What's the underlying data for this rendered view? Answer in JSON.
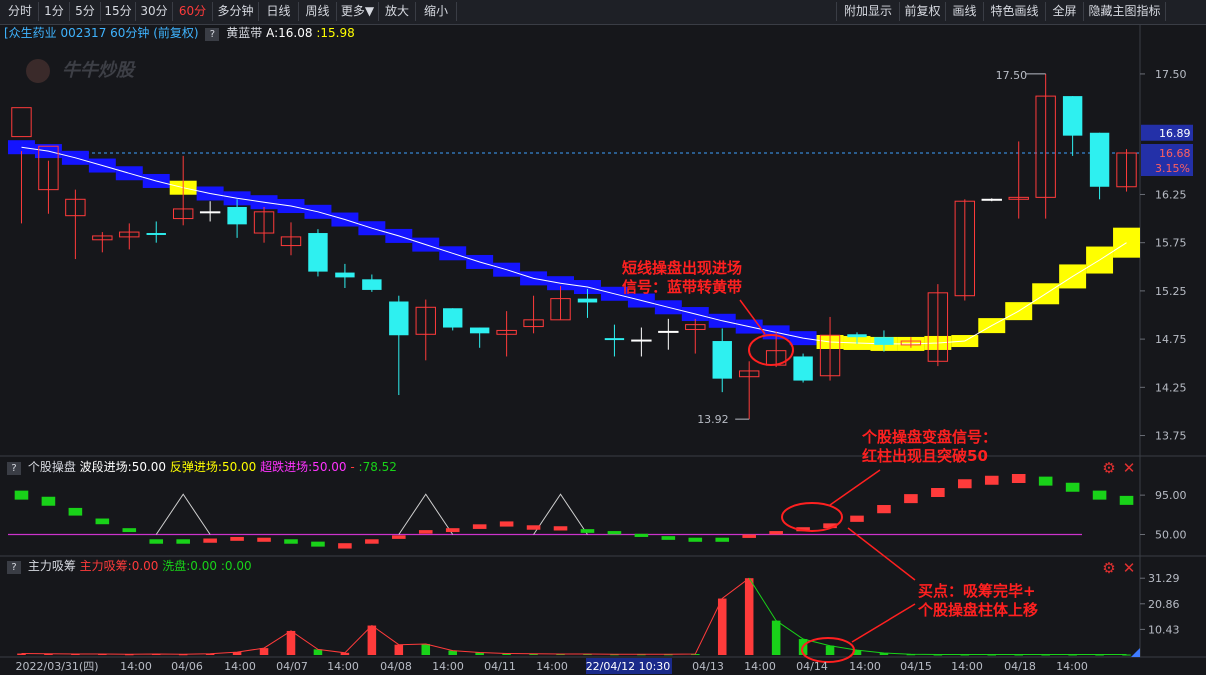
{
  "toolbar": {
    "left": [
      "分时",
      "1分",
      "5分",
      "15分",
      "30分",
      "60分",
      "多分钟",
      "日线",
      "周线",
      "更多▼",
      "放大",
      "缩小"
    ],
    "active_label": "60分",
    "right": [
      "附加显示",
      "前复权",
      "画线",
      "特色画线",
      "全屏",
      "隐藏主图指标"
    ]
  },
  "main_panel": {
    "stock": "[众生药业",
    "code": "002317 60分钟",
    "adjust": "(前复权)",
    "indicator_name": "黄蓝带",
    "a_label": "A:16.08",
    "b_value": ":15.98",
    "watermark": "牛牛炒股",
    "price_labels": [
      "17.50",
      "16.25",
      "15.75",
      "15.25",
      "14.75",
      "14.25",
      "13.75"
    ],
    "tag_high": "16.89",
    "tag_last": "16.68",
    "tag_pct": "3.15%",
    "max_label": "17.50",
    "min_label": "13.92",
    "annotation1_line1": "短线操盘出现进场",
    "annotation1_line2": "信号：蓝带转黄带"
  },
  "panel2": {
    "name": "个股操盘",
    "l1": "波段进场:50.00",
    "l2": "反弹进场:50.00",
    "l3": "超跌进场:50.00",
    "l4": "-",
    "l5": ":78.52",
    "axis": [
      "95.00",
      "50.00"
    ],
    "annotation_line1": "个股操盘变盘信号：",
    "annotation_line2": "红柱出现且突破50"
  },
  "panel3": {
    "name": "主力吸筹",
    "l1": "主力吸筹:0.00",
    "l2": "洗盘:0.00",
    "l3": ":0.00",
    "axis": [
      "31.29",
      "20.86",
      "10.43"
    ],
    "annotation_line1": "买点：吸筹完毕+",
    "annotation_line2": "个股操盘柱体上移"
  },
  "x_axis": [
    "2022/03/31(四)",
    "14:00",
    "04/06",
    "14:00",
    "04/07",
    "14:00",
    "04/08",
    "14:00",
    "04/11",
    "14:00",
    "22/04/12 10:30",
    "04/13",
    "14:00",
    "04/14",
    "14:00",
    "04/15",
    "14:00",
    "04/18",
    "14:00"
  ],
  "colors": {
    "up": "#ff3b3b",
    "down": "#2ef0f0",
    "blue_band": "#1414ff",
    "yellow_band": "#ffff00",
    "green": "#19d219",
    "magenta": "#cc33cc",
    "accent_tag": "#2330a8"
  },
  "chart_data": {
    "type": "candlestick",
    "candles": [
      [
        16.85,
        17.15,
        16.7,
        15.95
      ],
      [
        16.3,
        16.75,
        16.6,
        16.05
      ],
      [
        16.03,
        16.2,
        16.3,
        15.58
      ],
      [
        15.78,
        15.82,
        15.86,
        15.65
      ],
      [
        15.81,
        15.86,
        15.95,
        15.68
      ],
      [
        15.85,
        15.83,
        15.97,
        15.75
      ],
      [
        16.0,
        16.1,
        16.65,
        15.93
      ],
      [
        16.07,
        16.07,
        16.18,
        15.97
      ],
      [
        16.12,
        15.94,
        16.2,
        15.8
      ],
      [
        15.85,
        16.07,
        16.12,
        15.75
      ],
      [
        15.72,
        15.81,
        15.96,
        15.62
      ],
      [
        15.85,
        15.45,
        15.89,
        15.4
      ],
      [
        15.44,
        15.39,
        15.53,
        15.28
      ],
      [
        15.37,
        15.26,
        15.42,
        15.24
      ],
      [
        15.14,
        14.79,
        15.2,
        14.17
      ],
      [
        14.8,
        15.08,
        15.16,
        14.53
      ],
      [
        15.07,
        14.87,
        15.07,
        14.84
      ],
      [
        14.87,
        14.81,
        14.87,
        14.66
      ],
      [
        14.8,
        14.84,
        15.04,
        14.57
      ],
      [
        14.88,
        14.95,
        15.2,
        14.81
      ],
      [
        14.95,
        15.17,
        15.3,
        14.95
      ],
      [
        15.17,
        15.13,
        15.27,
        14.97
      ],
      [
        14.76,
        14.74,
        14.9,
        14.57
      ],
      [
        14.74,
        14.74,
        14.87,
        14.57
      ],
      [
        14.83,
        14.83,
        14.96,
        14.64
      ],
      [
        14.85,
        14.9,
        14.96,
        14.6
      ],
      [
        14.73,
        14.34,
        14.86,
        14.2
      ],
      [
        14.36,
        14.42,
        14.52,
        13.92
      ],
      [
        14.48,
        14.63,
        14.83,
        14.46
      ],
      [
        14.57,
        14.32,
        14.6,
        14.3
      ],
      [
        14.37,
        14.79,
        14.98,
        14.32
      ],
      [
        14.8,
        14.77,
        14.82,
        14.7
      ],
      [
        14.77,
        14.69,
        14.84,
        14.62
      ],
      [
        14.69,
        14.73,
        14.77,
        14.66
      ],
      [
        14.52,
        15.23,
        15.32,
        14.47
      ],
      [
        15.2,
        16.18,
        16.2,
        15.15
      ],
      [
        16.2,
        16.2,
        16.21,
        16.18
      ],
      [
        16.2,
        16.22,
        16.8,
        16.0
      ],
      [
        16.22,
        17.27,
        17.5,
        16.0
      ],
      [
        17.27,
        16.86,
        17.27,
        16.65
      ],
      [
        16.89,
        16.33,
        16.89,
        16.2
      ],
      [
        16.33,
        16.68,
        16.72,
        16.28
      ]
    ],
    "band": [
      16.74,
      16.7,
      16.63,
      16.55,
      16.47,
      16.39,
      16.32,
      16.26,
      16.21,
      16.17,
      16.13,
      16.07,
      15.99,
      15.9,
      15.82,
      15.73,
      15.64,
      15.55,
      15.47,
      15.38,
      15.33,
      15.29,
      15.22,
      15.15,
      15.08,
      15.01,
      14.94,
      14.88,
      14.82,
      14.76,
      14.72,
      14.71,
      14.7,
      14.7,
      14.71,
      14.73,
      14.89,
      15.04,
      15.22,
      15.4,
      15.57,
      15.75,
      15.92,
      16.03
    ],
    "band_color": [
      "b",
      "b",
      "b",
      "b",
      "b",
      "b",
      "y",
      "b",
      "b",
      "b",
      "b",
      "b",
      "b",
      "b",
      "b",
      "b",
      "b",
      "b",
      "b",
      "b",
      "b",
      "b",
      "b",
      "b",
      "b",
      "b",
      "b",
      "b",
      "b",
      "b",
      "y",
      "y",
      "y",
      "y",
      "y",
      "y",
      "y",
      "y",
      "y",
      "y",
      "y",
      "y",
      "y",
      "y"
    ],
    "ylim": [
      13.6,
      17.8
    ],
    "osc": {
      "values": [
        [
          95,
          "g"
        ],
        [
          88,
          "g"
        ],
        [
          76,
          "g"
        ],
        [
          65,
          "g"
        ],
        [
          55,
          "g"
        ],
        [
          42,
          "g"
        ],
        [
          42,
          "g"
        ],
        [
          43,
          "r"
        ],
        [
          45,
          "r"
        ],
        [
          44,
          "r"
        ],
        [
          42,
          "g"
        ],
        [
          39,
          "g"
        ],
        [
          37,
          "r"
        ],
        [
          42,
          "r"
        ],
        [
          47,
          "r"
        ],
        [
          53,
          "r"
        ],
        [
          55,
          "r"
        ],
        [
          59,
          "r"
        ],
        [
          62,
          "r"
        ],
        [
          58,
          "r"
        ],
        [
          57,
          "r"
        ],
        [
          54,
          "g"
        ],
        [
          52,
          "g"
        ],
        [
          49,
          "g"
        ],
        [
          46,
          "g"
        ],
        [
          44,
          "g"
        ],
        [
          44,
          "g"
        ],
        [
          48,
          "r"
        ],
        [
          52,
          "r"
        ],
        [
          56,
          "r"
        ],
        [
          60,
          "r"
        ],
        [
          68,
          "r"
        ],
        [
          79,
          "r"
        ],
        [
          91,
          "r"
        ],
        [
          98,
          "r"
        ],
        [
          108,
          "r"
        ],
        [
          112,
          "r"
        ],
        [
          114,
          "r"
        ],
        [
          111,
          "g"
        ],
        [
          104,
          "g"
        ],
        [
          95,
          "g"
        ],
        [
          89,
          "g"
        ]
      ],
      "baseline": 50,
      "ylim": [
        30,
        118
      ]
    },
    "volume": {
      "values": [
        [
          0.6,
          "r"
        ],
        [
          0.5,
          "r"
        ],
        [
          0.4,
          "r"
        ],
        [
          0.4,
          "r"
        ],
        [
          0.3,
          "r"
        ],
        [
          0.4,
          "r"
        ],
        [
          0.3,
          "r"
        ],
        [
          0.5,
          "r"
        ],
        [
          1.2,
          "r"
        ],
        [
          2.8,
          "r"
        ],
        [
          9.8,
          "r"
        ],
        [
          2.3,
          "g"
        ],
        [
          0.9,
          "r"
        ],
        [
          12.0,
          "r"
        ],
        [
          4.2,
          "r"
        ],
        [
          4.5,
          "g"
        ],
        [
          1.8,
          "g"
        ],
        [
          1.0,
          "g"
        ],
        [
          0.6,
          "g"
        ],
        [
          0.5,
          "g"
        ],
        [
          0.4,
          "g"
        ],
        [
          0.4,
          "g"
        ],
        [
          0.3,
          "g"
        ],
        [
          0.3,
          "g"
        ],
        [
          0.3,
          "g"
        ],
        [
          0.4,
          "g"
        ],
        [
          23.0,
          "r"
        ],
        [
          31.29,
          "r"
        ],
        [
          14.0,
          "g"
        ],
        [
          6.5,
          "g"
        ],
        [
          3.8,
          "g"
        ],
        [
          2.0,
          "g"
        ],
        [
          0.8,
          "g"
        ],
        [
          0.3,
          "g"
        ],
        [
          0.2,
          "g"
        ],
        [
          0.2,
          "g"
        ],
        [
          0.2,
          "g"
        ],
        [
          0.2,
          "g"
        ],
        [
          0.2,
          "g"
        ],
        [
          0.2,
          "g"
        ],
        [
          0.2,
          "g"
        ],
        [
          0.2,
          "g"
        ]
      ],
      "ylim": [
        0,
        33
      ]
    }
  }
}
